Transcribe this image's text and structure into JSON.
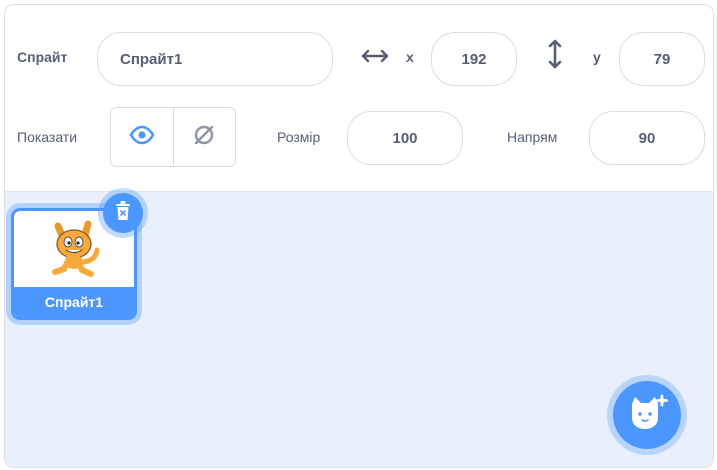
{
  "sprite_info": {
    "sprite_label": "Спрайт",
    "sprite_name": "Спрайт1",
    "x_label": "x",
    "x_value": "192",
    "y_label": "y",
    "y_value": "79",
    "show_label": "Показати",
    "size_label": "Розмір",
    "size_value": "100",
    "direction_label": "Напрям",
    "direction_value": "90"
  },
  "sprites": [
    {
      "name": "Спрайт1",
      "selected": true
    }
  ],
  "colors": {
    "accent": "#4c97ff",
    "text": "#575e75",
    "pane_background": "#e9f0fb"
  },
  "icons": [
    "x-arrows-icon",
    "y-arrows-icon",
    "show-eye-icon",
    "hide-eye-icon",
    "cat-sprite-thumbnail",
    "trash-icon",
    "add-sprite-cat-icon"
  ]
}
